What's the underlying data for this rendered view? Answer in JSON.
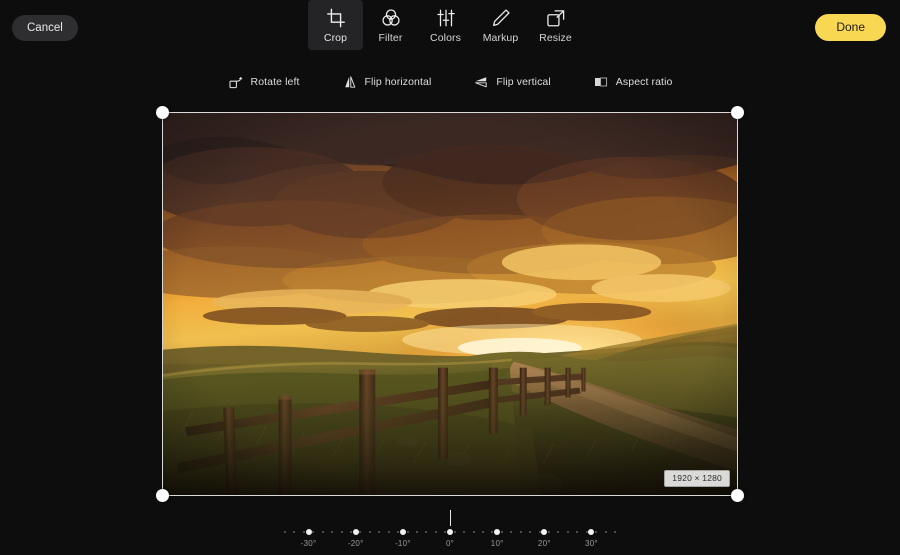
{
  "topbar": {
    "cancel_label": "Cancel",
    "done_label": "Done",
    "done_color": "#f8d753"
  },
  "tools": [
    {
      "label": "Crop",
      "icon": "crop-icon",
      "active": true
    },
    {
      "label": "Filter",
      "icon": "filter-icon",
      "active": false
    },
    {
      "label": "Colors",
      "icon": "colors-icon",
      "active": false
    },
    {
      "label": "Markup",
      "icon": "markup-icon",
      "active": false
    },
    {
      "label": "Resize",
      "icon": "resize-icon",
      "active": false
    }
  ],
  "crop_actions": [
    {
      "label": "Rotate left",
      "icon": "rotate-left-icon"
    },
    {
      "label": "Flip horizontal",
      "icon": "flip-horizontal-icon"
    },
    {
      "label": "Flip vertical",
      "icon": "flip-vertical-icon"
    },
    {
      "label": "Aspect ratio",
      "icon": "aspect-ratio-icon"
    }
  ],
  "canvas": {
    "dimensions_badge": "1920 × 1280",
    "image_description": "Sunset over rolling hills with a wooden fence along a dirt path",
    "handles": [
      "top-left",
      "top-right",
      "bottom-left",
      "bottom-right"
    ]
  },
  "rotation": {
    "value": "0°",
    "ticks": [
      "-30°",
      "-20°",
      "-10°",
      "0°",
      "10°",
      "20°",
      "30°"
    ],
    "min": -35,
    "max": 35
  }
}
